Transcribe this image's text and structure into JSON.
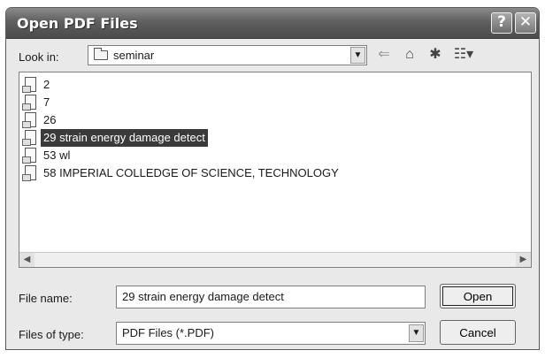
{
  "window": {
    "title": "Open PDF Files",
    "help_glyph": "?",
    "close_glyph": "✕"
  },
  "lookin": {
    "label": "Look in:",
    "value": "seminar",
    "dropdown_glyph": "▼"
  },
  "toolbar": {
    "back_glyph": "⇐",
    "up_glyph": "⌂",
    "newfolder_glyph": "✱",
    "views_glyph": "☷▾"
  },
  "files": [
    {
      "name": "2",
      "selected": false
    },
    {
      "name": "7",
      "selected": false
    },
    {
      "name": "26",
      "selected": false
    },
    {
      "name": "29 strain energy damage detect",
      "selected": true
    },
    {
      "name": "53 wl",
      "selected": false
    },
    {
      "name": "58 IMPERIAL COLLEDGE OF SCIENCE, TECHNOLOGY",
      "selected": false
    }
  ],
  "scroll": {
    "left_glyph": "◀",
    "right_glyph": "▶"
  },
  "form": {
    "filename_label": "File name:",
    "filename_value": "29 strain energy damage detect",
    "filetype_label": "Files of type:",
    "filetype_value": "PDF Files (*.PDF)",
    "filetype_dropdown_glyph": "▼"
  },
  "buttons": {
    "open": "Open",
    "cancel": "Cancel"
  }
}
